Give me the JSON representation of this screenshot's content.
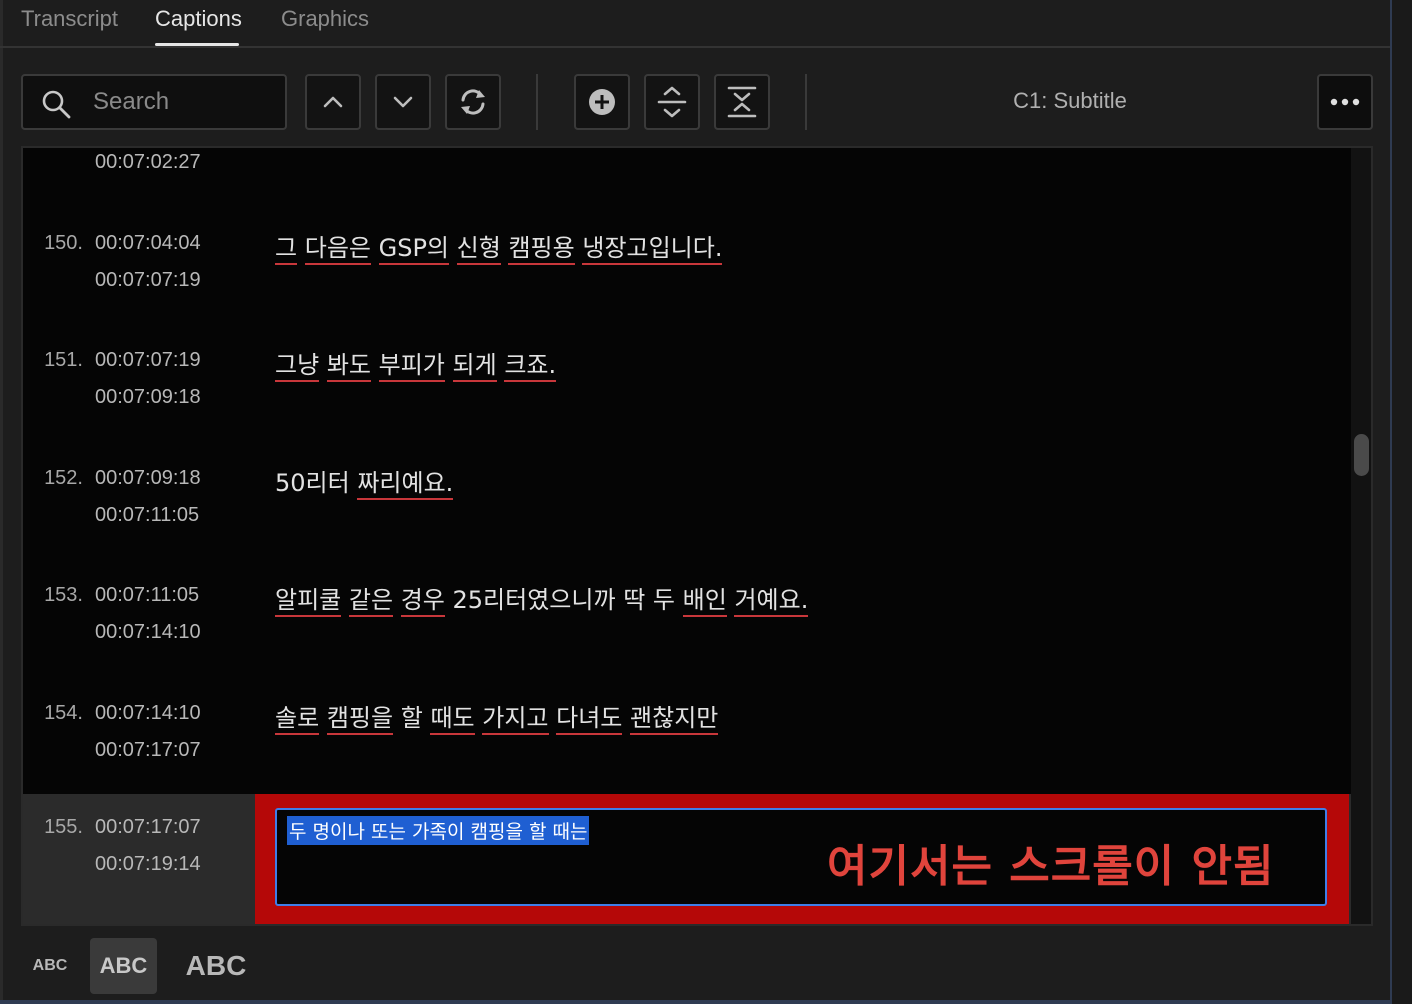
{
  "tabs": [
    {
      "label": "Transcript",
      "active": false
    },
    {
      "label": "Captions",
      "active": true
    },
    {
      "label": "Graphics",
      "active": false
    }
  ],
  "toolbar": {
    "search_placeholder": "Search",
    "track_label": "C1: Subtitle"
  },
  "rows": [
    {
      "num": "",
      "time_in": "",
      "time_out": "00:07:02:27",
      "words": []
    },
    {
      "num": "150.",
      "time_in": "00:07:04:04",
      "time_out": "00:07:07:19",
      "words": [
        {
          "t": "그",
          "u": true
        },
        {
          "t": " ",
          "u": false
        },
        {
          "t": "다음은",
          "u": true
        },
        {
          "t": " ",
          "u": false
        },
        {
          "t": "GSP의",
          "u": true
        },
        {
          "t": " ",
          "u": false
        },
        {
          "t": "신형",
          "u": true
        },
        {
          "t": " ",
          "u": false
        },
        {
          "t": "캠핑용",
          "u": true
        },
        {
          "t": " ",
          "u": false
        },
        {
          "t": "냉장고입니다.",
          "u": true
        }
      ]
    },
    {
      "num": "151.",
      "time_in": "00:07:07:19",
      "time_out": "00:07:09:18",
      "words": [
        {
          "t": "그냥",
          "u": true
        },
        {
          "t": " ",
          "u": false
        },
        {
          "t": "봐도",
          "u": true
        },
        {
          "t": " ",
          "u": false
        },
        {
          "t": "부피가",
          "u": true
        },
        {
          "t": " ",
          "u": false
        },
        {
          "t": "되게",
          "u": true
        },
        {
          "t": " ",
          "u": false
        },
        {
          "t": "크죠.",
          "u": true
        }
      ]
    },
    {
      "num": "152.",
      "time_in": "00:07:09:18",
      "time_out": "00:07:11:05",
      "words": [
        {
          "t": "50리터",
          "u": false
        },
        {
          "t": " ",
          "u": false
        },
        {
          "t": "짜리예요.",
          "u": true
        }
      ]
    },
    {
      "num": "153.",
      "time_in": "00:07:11:05",
      "time_out": "00:07:14:10",
      "words": [
        {
          "t": "알피쿨",
          "u": true
        },
        {
          "t": " ",
          "u": false
        },
        {
          "t": "같은",
          "u": true
        },
        {
          "t": " ",
          "u": false
        },
        {
          "t": "경우",
          "u": true
        },
        {
          "t": " ",
          "u": false
        },
        {
          "t": "25리터였으니까",
          "u": false
        },
        {
          "t": " ",
          "u": false
        },
        {
          "t": "딱",
          "u": false
        },
        {
          "t": " ",
          "u": false
        },
        {
          "t": "두",
          "u": false
        },
        {
          "t": " ",
          "u": false
        },
        {
          "t": "배인",
          "u": true
        },
        {
          "t": " ",
          "u": false
        },
        {
          "t": "거예요.",
          "u": true
        }
      ]
    },
    {
      "num": "154.",
      "time_in": "00:07:14:10",
      "time_out": "00:07:17:07",
      "words": [
        {
          "t": "솔로",
          "u": true
        },
        {
          "t": " ",
          "u": false
        },
        {
          "t": "캠핑을",
          "u": true
        },
        {
          "t": " ",
          "u": false
        },
        {
          "t": "할",
          "u": false
        },
        {
          "t": " ",
          "u": false
        },
        {
          "t": "때도",
          "u": true
        },
        {
          "t": " ",
          "u": false
        },
        {
          "t": "가지고",
          "u": true
        },
        {
          "t": " ",
          "u": false
        },
        {
          "t": "다녀도",
          "u": true
        },
        {
          "t": " ",
          "u": false
        },
        {
          "t": "괜찮지만 ",
          "u": true
        }
      ]
    }
  ],
  "selected_row": {
    "num": "155.",
    "time_in": "00:07:17:07",
    "time_out": "00:07:19:14",
    "edit_text": "두 명이나 또는 가족이 캠핑을 할 때는",
    "annotation": "여기서는 스크롤이 안됨"
  },
  "bottom": {
    "small": "ABC",
    "medium": "ABC",
    "large": "ABC"
  },
  "colors": {
    "accent_blue": "#3f7ee8",
    "annotation_red": "#e0443c",
    "highlight_red": "#b50808",
    "underline_red": "#c8373b"
  }
}
